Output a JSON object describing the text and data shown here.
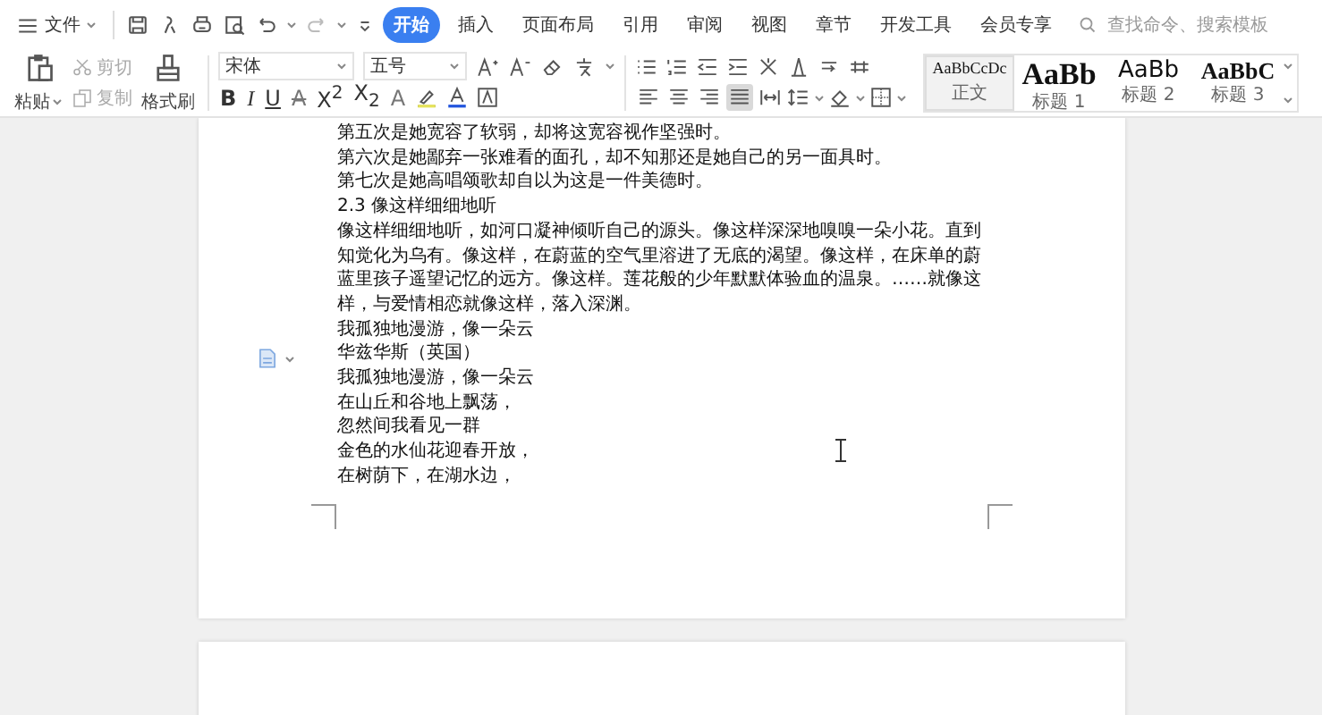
{
  "topbar": {
    "file_menu": "文件",
    "tabs": [
      {
        "label": "开始",
        "selected": true
      },
      {
        "label": "插入",
        "selected": false
      },
      {
        "label": "页面布局",
        "selected": false
      },
      {
        "label": "引用",
        "selected": false
      },
      {
        "label": "审阅",
        "selected": false
      },
      {
        "label": "视图",
        "selected": false
      },
      {
        "label": "章节",
        "selected": false
      },
      {
        "label": "开发工具",
        "selected": false
      },
      {
        "label": "会员专享",
        "selected": false
      }
    ],
    "search": {
      "placeholder": "查找命令、搜索模板"
    }
  },
  "ribbon": {
    "paste": "粘贴",
    "cut": "剪切",
    "copy": "复制",
    "format_painter": "格式刷",
    "font": "宋体",
    "font_size": "五号",
    "format_buttons": [
      {
        "label": "B",
        "kind": "bold"
      },
      {
        "label": "I",
        "kind": "italic"
      },
      {
        "label": "U",
        "kind": "underline"
      },
      {
        "label": "A",
        "kind": "strike"
      },
      {
        "label": "X$^{2}$",
        "kind": "plain"
      },
      {
        "label": "X$_{2}$",
        "kind": "plain"
      },
      {
        "label": "A",
        "kind": "outline"
      }
    ],
    "align_buttons": [
      {
        "kind": "left",
        "selected": false
      },
      {
        "kind": "center",
        "selected": false
      },
      {
        "kind": "right",
        "selected": false
      },
      {
        "kind": "justify",
        "selected": true
      },
      {
        "kind": "distributed",
        "selected": false
      }
    ],
    "styles": [
      {
        "preview": "AaBbCcDc",
        "label": "正文",
        "kind": "normal",
        "selected": true
      },
      {
        "preview": "AaBb",
        "label": "标题 1",
        "kind": "heading1",
        "selected": false
      },
      {
        "preview": "AaBb",
        "label": "标题 2",
        "kind": "heading2",
        "selected": false
      },
      {
        "preview": "AaBbC",
        "label": "标题 3",
        "kind": "heading3",
        "selected": false
      }
    ]
  },
  "document": {
    "paragraphs": [
      "第五次是她宽容了软弱，却将这宽容视作坚强时。",
      "第六次是她鄙弃一张难看的面孔，却不知那还是她自己的另一面具时。",
      "第七次是她高唱颂歌却自以为这是一件美德时。",
      "2.3 像这样细细地听",
      "像这样细细地听，如河口凝神倾听自己的源头。像这样深深地嗅嗅一朵小花。直到知觉化为乌有。像这样，在蔚蓝的空气里溶进了无底的渴望。像这样，在床单的蔚蓝里孩子遥望记忆的远方。像这样。莲花般的少年默默体验血的温泉。……就像这样，与爱情相恋就像这样，落入深渊。",
      "我孤独地漫游，像一朵云",
      "华兹华斯（英国）",
      "我孤独地漫游，像一朵云",
      "在山丘和谷地上飘荡，",
      "忽然间我看见一群",
      "金色的水仙花迎春开放，",
      "在树荫下，在湖水边，"
    ]
  }
}
